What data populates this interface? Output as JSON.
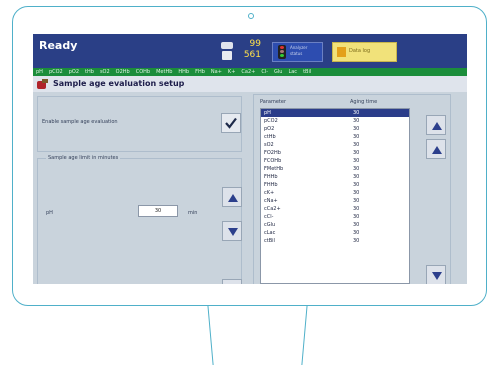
{
  "statusbar": {
    "status": "Ready",
    "count_top": "99",
    "count_bottom": "561",
    "traffic_btn_label": "Analyzer status",
    "folder_btn_label": "Data log"
  },
  "tabs": [
    "pH",
    "pCO2",
    "pO2",
    "tHb",
    "sO2",
    "O2Hb",
    "COHb",
    "MetHb",
    "HHb",
    "FHb",
    "Na+",
    "K+",
    "Ca2+",
    "Cl-",
    "Glu",
    "Lac",
    "tBil"
  ],
  "page": {
    "title": "Sample age evaluation setup"
  },
  "left": {
    "enable_label": "Enable sample age evaluation",
    "group_title": "Sample age limit in minutes",
    "param_label": "pH",
    "age_value": "30",
    "unit": "min"
  },
  "right": {
    "col_parameter": "Parameter",
    "col_age": "Aging time",
    "rows": [
      {
        "parameter": "pH",
        "age": "30",
        "selected": true
      },
      {
        "parameter": "pCO2",
        "age": "30"
      },
      {
        "parameter": "pO2",
        "age": "30"
      },
      {
        "parameter": "ctHb",
        "age": "30"
      },
      {
        "parameter": "sO2",
        "age": "30"
      },
      {
        "parameter": "FO2Hb",
        "age": "30"
      },
      {
        "parameter": "FCOHb",
        "age": "30"
      },
      {
        "parameter": "FMetHb",
        "age": "30"
      },
      {
        "parameter": "FHHb",
        "age": "30"
      },
      {
        "parameter": "FHHb",
        "age": "30"
      },
      {
        "parameter": "cK+",
        "age": "30"
      },
      {
        "parameter": "cNa+",
        "age": "30"
      },
      {
        "parameter": "cCa2+",
        "age": "30"
      },
      {
        "parameter": "cCl-",
        "age": "30"
      },
      {
        "parameter": "cGlu",
        "age": "30"
      },
      {
        "parameter": "cLac",
        "age": "30"
      },
      {
        "parameter": "ctBil",
        "age": "30"
      }
    ]
  }
}
